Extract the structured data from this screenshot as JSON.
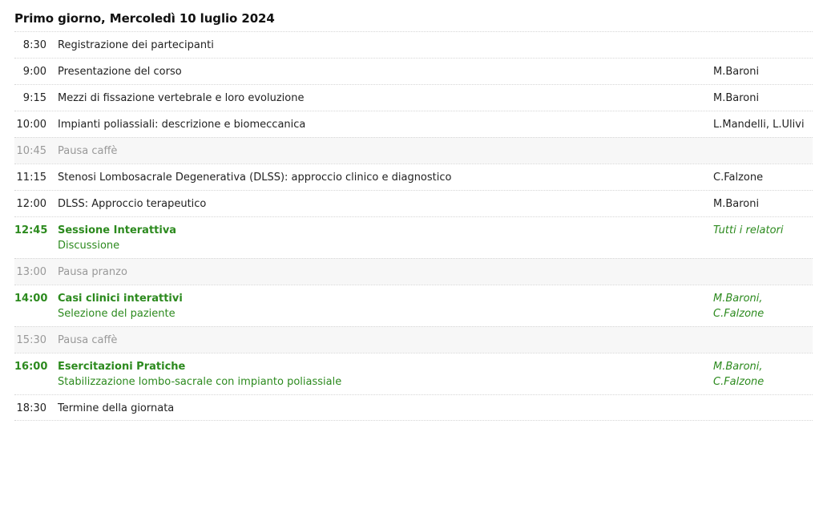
{
  "day": {
    "title": "Primo giorno, Mercoledì 10 luglio 2024"
  },
  "schedule": [
    {
      "time": "8:30",
      "title": "Registrazione dei partecipanti",
      "speaker": ""
    },
    {
      "time": "9:00",
      "title": "Presentazione del corso",
      "speaker": "M.Baroni"
    },
    {
      "time": "9:15",
      "title": "Mezzi di fissazione vertebrale e loro evoluzione",
      "speaker": "M.Baroni"
    },
    {
      "time": "10:00",
      "title": "Impianti poliassiali: descrizione e biomeccanica",
      "speaker": "L.Mandelli, L.Ulivi"
    },
    {
      "time": "10:45",
      "title": "Pausa caffè",
      "speaker": ""
    },
    {
      "time": "11:15",
      "title": "Stenosi Lombosacrale Degenerativa (DLSS): approccio clinico e diagnostico",
      "speaker": "C.Falzone"
    },
    {
      "time": "12:00",
      "title": "DLSS: Approccio terapeutico",
      "speaker": "M.Baroni"
    },
    {
      "time": "12:45",
      "title": "Sessione Interattiva",
      "subtitle": "Discussione",
      "speaker": "Tutti i relatori"
    },
    {
      "time": "13:00",
      "title": "Pausa pranzo",
      "speaker": ""
    },
    {
      "time": "14:00",
      "title": "Casi clinici interattivi",
      "subtitle": "Selezione del paziente",
      "speaker_lines": [
        "M.Baroni,",
        "C.Falzone"
      ]
    },
    {
      "time": "15:30",
      "title": "Pausa caffè",
      "speaker": ""
    },
    {
      "time": "16:00",
      "title": "Esercitazioni Pratiche",
      "subtitle": "Stabilizzazione lombo-sacrale con impianto poliassiale",
      "speaker_lines": [
        "M.Baroni,",
        "C.Falzone"
      ]
    },
    {
      "time": "18:30",
      "title": "Termine della giornata",
      "speaker": ""
    }
  ],
  "colors": {
    "session": "#2c8a1e",
    "pause_text": "#999999",
    "pause_background": "#f7f7f7"
  }
}
